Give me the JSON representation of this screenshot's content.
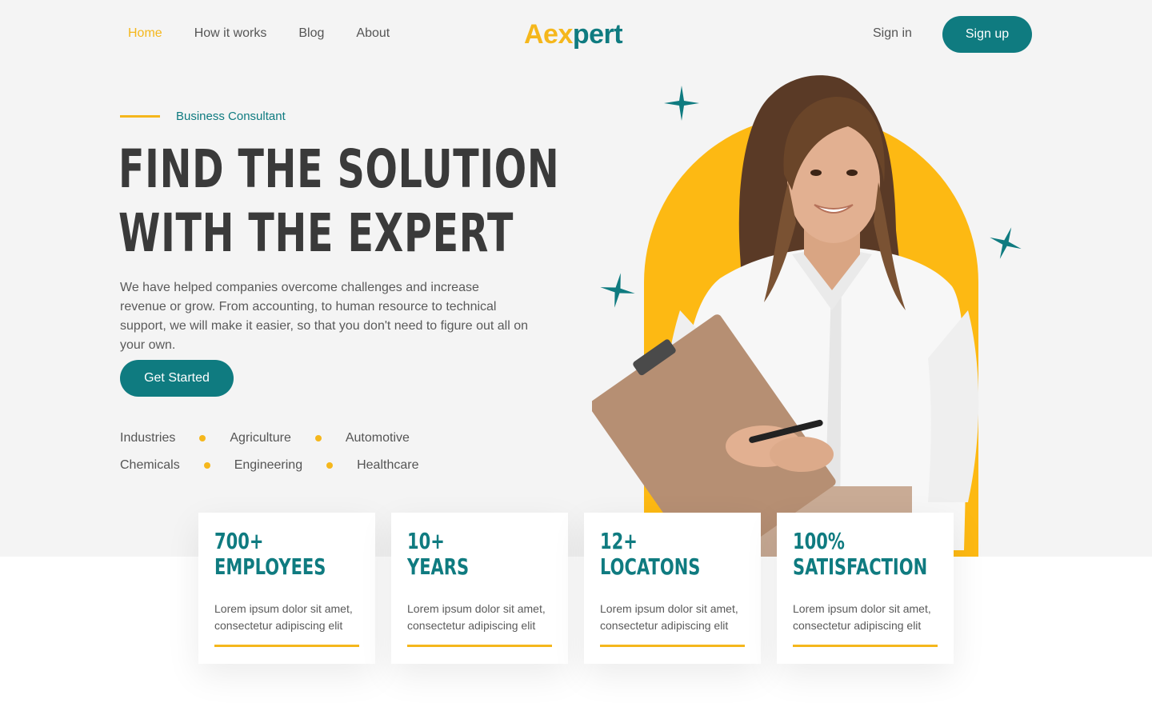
{
  "nav": {
    "links": [
      {
        "label": "Home",
        "active": true
      },
      {
        "label": "How it works",
        "active": false
      },
      {
        "label": "Blog",
        "active": false
      },
      {
        "label": "About",
        "active": false
      }
    ],
    "logo_part1": "Aex",
    "logo_part2": "pert",
    "signin_label": "Sign in",
    "signup_label": "Sign up"
  },
  "hero": {
    "eyebrow": "Business Consultant",
    "headline_line1": "FIND THE SOLUTION",
    "headline_line2": "WITH THE EXPERT",
    "lead": "We have helped companies overcome challenges and increase revenue or grow. From accounting, to human resource to technical support, we will make it easier, so that you don't need to figure out all on your own.",
    "cta_label": "Get Started",
    "industries_row1": [
      "Industries",
      "Agriculture",
      "Automotive"
    ],
    "industries_row2": [
      "Chemicals",
      "Engineering",
      "Healthcare"
    ]
  },
  "stats": [
    {
      "value": "700+",
      "label": "EMPLOYEES",
      "desc": "Lorem ipsum dolor sit amet, consectetur adipiscing elit"
    },
    {
      "value": "10+",
      "label": "YEARS",
      "desc": "Lorem ipsum dolor sit amet, consectetur adipiscing elit"
    },
    {
      "value": "12+",
      "label": "LOCATONS",
      "desc": "Lorem ipsum dolor sit amet, consectetur adipiscing elit"
    },
    {
      "value": "100%",
      "label": "SATISFACTION",
      "desc": "Lorem ipsum dolor sit amet, consectetur adipiscing elit"
    }
  ],
  "colors": {
    "accent": "#f5b71c",
    "brand": "#0f7b80",
    "arch": "#fdb913"
  }
}
